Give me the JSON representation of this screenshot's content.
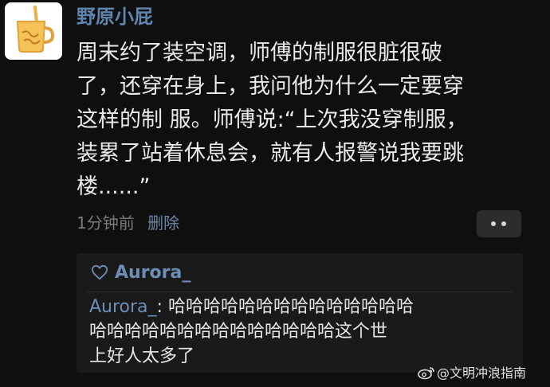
{
  "post": {
    "username": "野原小屁",
    "body_lines": [
      "周末约了装空调，师傅的制服很脏很破",
      "了，还穿在身上，我问他为什么一定要穿",
      "这样的制 服。师傅说:“上次我没穿制服，",
      "装累了站着休息会，就有人报警说我要跳",
      "楼......”"
    ],
    "time": "1分钟前",
    "delete_label": "删除"
  },
  "comment": {
    "like_user": "Aurora_",
    "author": "Aurora_",
    "separator": ": ",
    "line1_text": "哈哈哈哈哈哈哈哈哈哈哈哈哈哈",
    "line2": "哈哈哈哈哈哈哈哈哈哈哈哈哈哈这个世",
    "line3": "上好人太多了"
  },
  "watermark": {
    "text": "@文明冲浪指南"
  },
  "icons": {
    "avatar": "drink-cup-icon",
    "like": "heart-outline-icon",
    "more": "more-dots-icon",
    "watermark": "weibo-icon"
  },
  "colors": {
    "background": "#0f0f0f",
    "username": "#5f84ad",
    "link": "#6d8fb6",
    "muted": "#7a7a7a",
    "comment_box": "#1a1a1a"
  }
}
